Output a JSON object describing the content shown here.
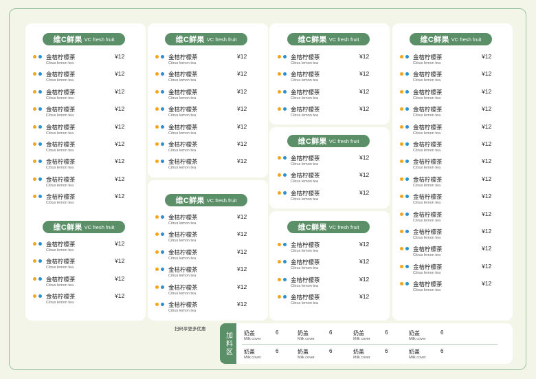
{
  "menu": {
    "header_cn": "维C鲜果",
    "header_en": "VC fresh fruit",
    "item_name": "金桔柠檬茶",
    "item_sub": "Citrus lemon tea",
    "item_price": "¥12"
  },
  "promo_text": "扫码享更多优惠",
  "addon": {
    "tab_label": "加料区",
    "item_name": "奶盖",
    "item_sub": "Milk cover",
    "item_price": "6"
  },
  "colors": {
    "header": "#5a8f67",
    "dot_orange": "#f3a51d",
    "dot_blue": "#2b8fd0",
    "background": "#f2f5e8"
  }
}
